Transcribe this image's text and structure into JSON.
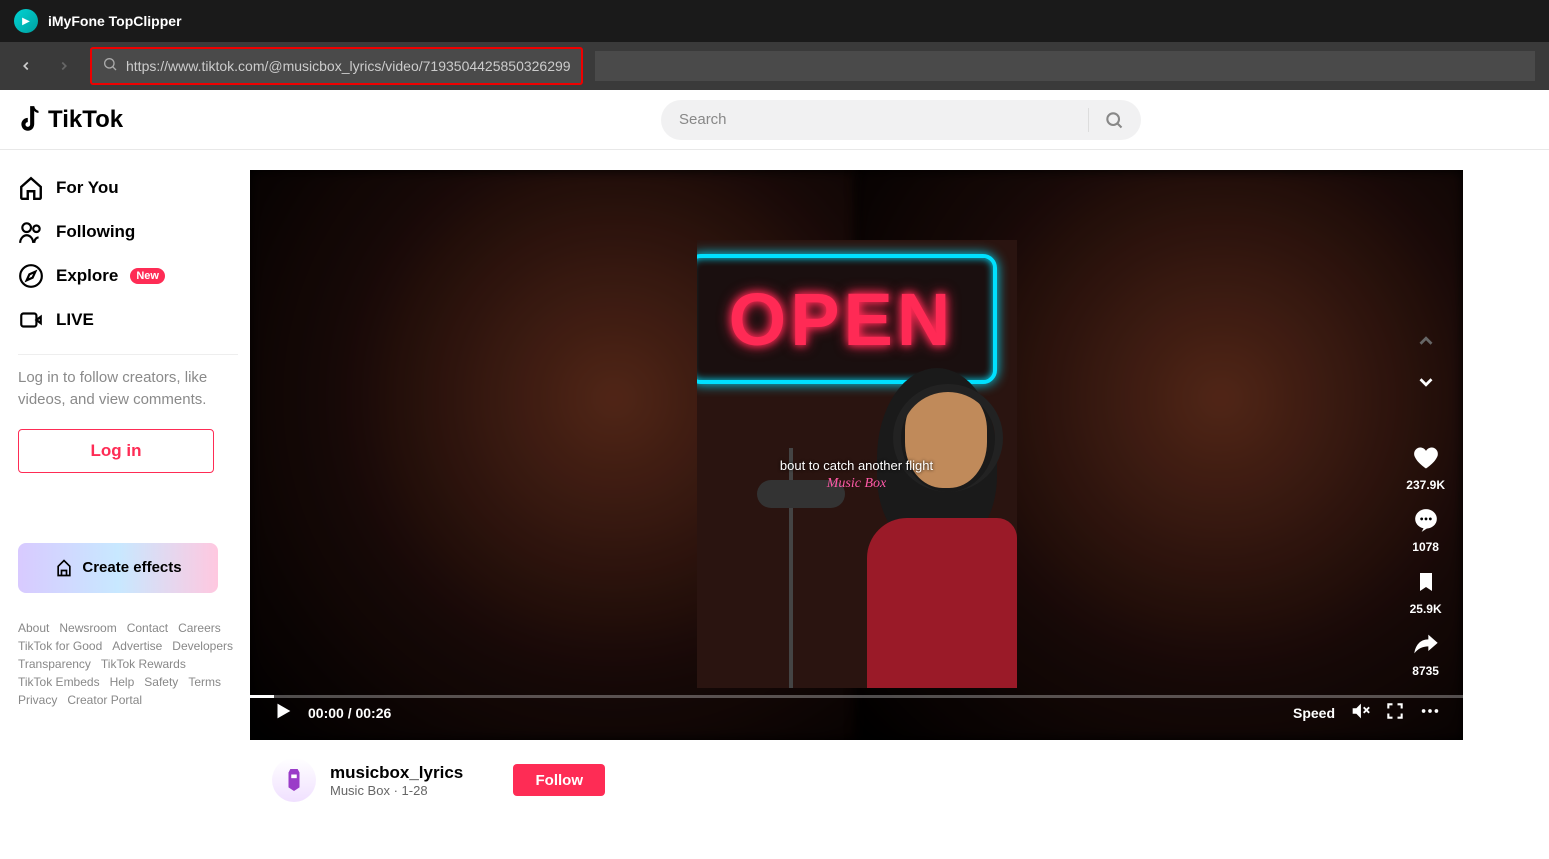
{
  "app": {
    "title": "iMyFone TopClipper"
  },
  "nav": {
    "url": "https://www.tiktok.com/@musicbox_lyrics/video/7193504425850326299"
  },
  "header": {
    "logo_text": "TikTok",
    "search_placeholder": "Search"
  },
  "sidebar": {
    "items": [
      {
        "label": "For You"
      },
      {
        "label": "Following"
      },
      {
        "label": "Explore",
        "badge": "New"
      },
      {
        "label": "LIVE"
      }
    ],
    "login_prompt": "Log in to follow creators, like videos, and view comments.",
    "login_btn": "Log in",
    "effects_btn": "Create effects",
    "footer": [
      "About",
      "Newsroom",
      "Contact",
      "Careers",
      "TikTok for Good",
      "Advertise",
      "Developers",
      "Transparency",
      "TikTok Rewards",
      "TikTok Embeds",
      "Help",
      "Safety",
      "Terms",
      "Privacy",
      "Creator Portal"
    ]
  },
  "video": {
    "neon_text": "OPEN",
    "caption": "bout to catch another flight",
    "watermark": "Music Box",
    "time_current": "00:00",
    "time_sep": " / ",
    "time_total": "00:26",
    "speed_label": "Speed",
    "actions": {
      "likes": "237.9K",
      "comments": "1078",
      "bookmarks": "25.9K",
      "shares": "8735"
    }
  },
  "meta": {
    "username": "musicbox_lyrics",
    "display_name": "Music Box",
    "date": "1-28",
    "follow": "Follow"
  }
}
